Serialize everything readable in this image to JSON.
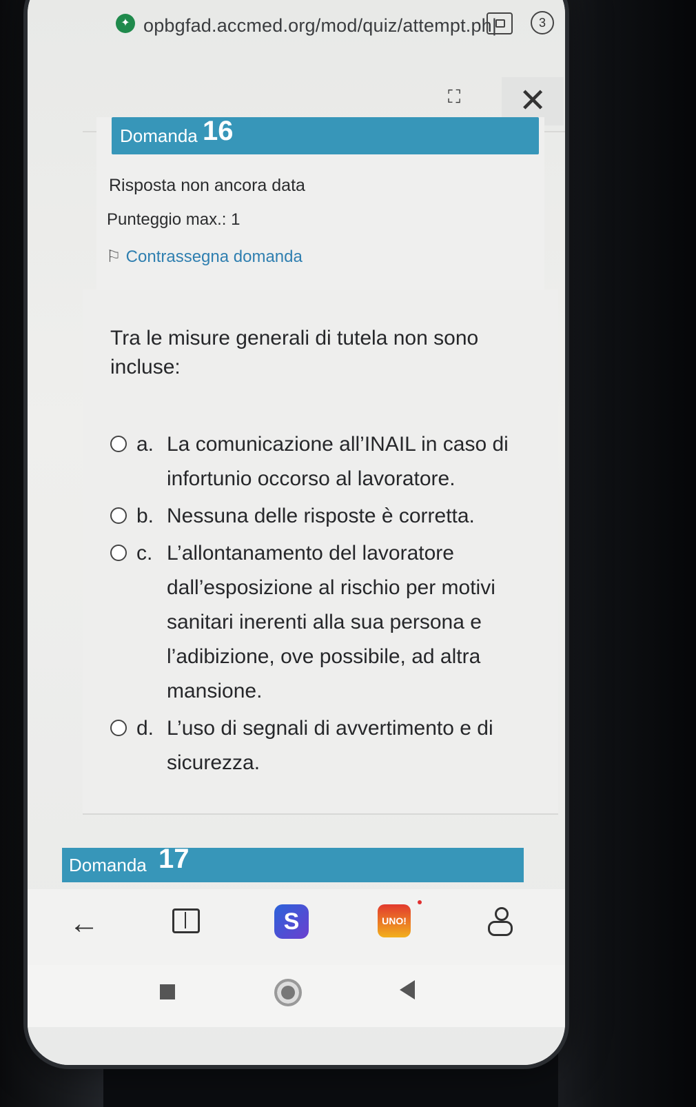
{
  "browser": {
    "url": "opbgfad.accmed.org/mod/quiz/attempt.ph|",
    "tab_count": "3"
  },
  "question": {
    "label": "Domanda",
    "number": "16",
    "status": "Risposta non ancora data",
    "score": "Punteggio max.: 1",
    "flag_label": "Contrassegna domanda",
    "text": "Tra le misure generali di tutela non sono incluse:",
    "answers": [
      {
        "letter": "a.",
        "text": "La comunicazione all’INAIL in caso di infortunio occorso al lavoratore."
      },
      {
        "letter": "b.",
        "text": "Nessuna delle risposte è corretta."
      },
      {
        "letter": "c.",
        "text": "L’allontanamento del lavoratore dall’esposizione al rischio per motivi sanitari inerenti alla sua persona e l’adibizione, ove possibile, ad altra mansione."
      },
      {
        "letter": "d.",
        "text": "L’uso di segnali di avvertimento e di sicurezza."
      }
    ]
  },
  "next_question": {
    "label": "Domanda",
    "number": "17"
  },
  "app_bar": {
    "uno_label": "UNO!"
  },
  "colors": {
    "banner": "#3796b9",
    "link": "#2f7fb0"
  }
}
